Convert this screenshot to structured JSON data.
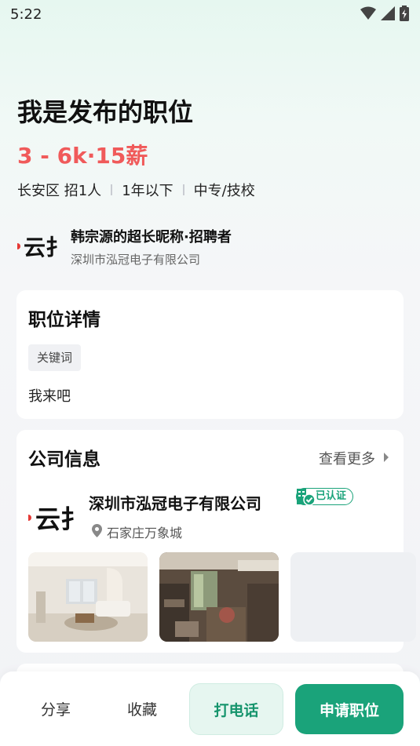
{
  "status_bar": {
    "time": "5:22"
  },
  "job": {
    "title": "我是发布的职位",
    "salary": "3 - 6k·15薪",
    "meta": [
      "长安区 招1人",
      "1年以下",
      "中专/技校"
    ]
  },
  "recruiter": {
    "logo_text": "云扌",
    "name": "韩宗源的超长昵称·招聘者",
    "company": "深圳市泓冠电子有限公司"
  },
  "job_details": {
    "title": "职位详情",
    "keyword": "关键词",
    "description": "我来吧"
  },
  "company_info": {
    "title": "公司信息",
    "see_more": "查看更多",
    "logo_text": "云扌",
    "name": "深圳市泓冠电子有限公司",
    "verified_label": "已认证",
    "location": "石家庄万象城"
  },
  "bottom_bar": {
    "share": "分享",
    "favorite": "收藏",
    "call": "打电话",
    "apply": "申请职位"
  },
  "colors": {
    "accent": "#1aa37a",
    "salary": "#f05a5a"
  }
}
